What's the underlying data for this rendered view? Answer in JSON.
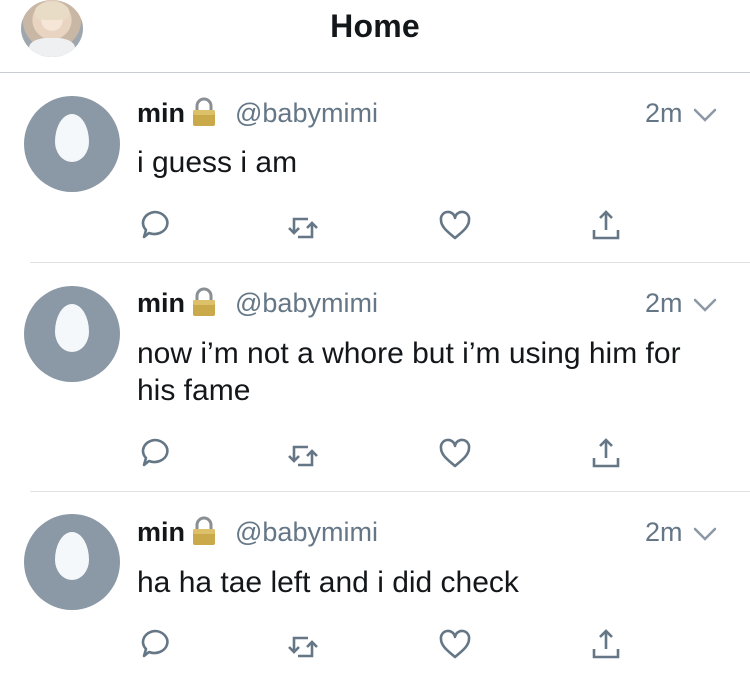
{
  "header": {
    "title": "Home",
    "avatar_icon": "user-avatar-photo"
  },
  "colors": {
    "text_primary": "#14171a",
    "text_secondary": "#657786",
    "icon_gray": "#657786",
    "egg_gray": "#8b98a5",
    "divider": "#dfe3e6"
  },
  "tweets": [
    {
      "name": "min",
      "locked": true,
      "handle": "@babymimi",
      "time": "2m",
      "text": "i guess i am"
    },
    {
      "name": "min",
      "locked": true,
      "handle": "@babymimi",
      "time": "2m",
      "text": "now i’m not a whore but i’m using him for his fame"
    },
    {
      "name": "min",
      "locked": true,
      "handle": "@babymimi",
      "time": "2m",
      "text": "ha ha tae left and i did check"
    }
  ],
  "actions": [
    "reply-icon",
    "retweet-icon",
    "like-icon",
    "share-icon"
  ]
}
